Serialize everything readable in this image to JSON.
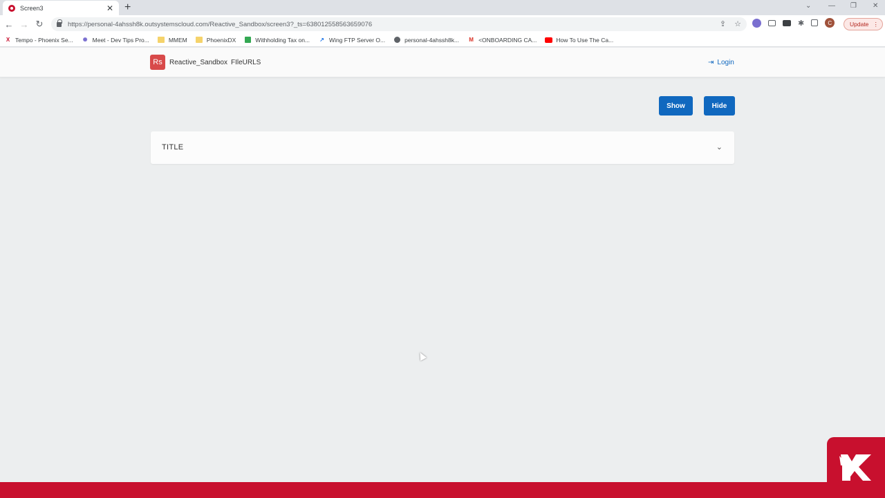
{
  "browser": {
    "tab_title": "Screen3",
    "url": "https://personal-4ahssh8k.outsystemscloud.com/Reactive_Sandbox/screen3?_ts=638012558563659076",
    "update_label": "Update",
    "avatar_letter": "C",
    "bookmarks": [
      {
        "label": "Tempo - Phoenix Se...",
        "icon": "phoenix-icon"
      },
      {
        "label": "Meet - Dev Tips Pro...",
        "icon": "meet-icon"
      },
      {
        "label": "MMEM",
        "icon": "folder-icon"
      },
      {
        "label": "PhoenixDX",
        "icon": "folder-icon"
      },
      {
        "label": "Withholding Tax on...",
        "icon": "sheet-icon"
      },
      {
        "label": "Wing FTP Server O...",
        "icon": "wing-icon"
      },
      {
        "label": "personal-4ahssh8k...",
        "icon": "globe-icon"
      },
      {
        "label": "<ONBOARDING CA...",
        "icon": "gmail-icon"
      },
      {
        "label": "How To Use The Ca...",
        "icon": "youtube-icon"
      }
    ]
  },
  "app": {
    "logo_text": "Rs",
    "name": "Reactive_Sandbox",
    "menu_item": "FIleURLS",
    "login_label": "Login",
    "show_label": "Show",
    "hide_label": "Hide",
    "section_title": "TITLE"
  },
  "colors": {
    "accent": "#1068bf",
    "brand_red": "#c8102e",
    "logo_red": "#d84a4a"
  }
}
